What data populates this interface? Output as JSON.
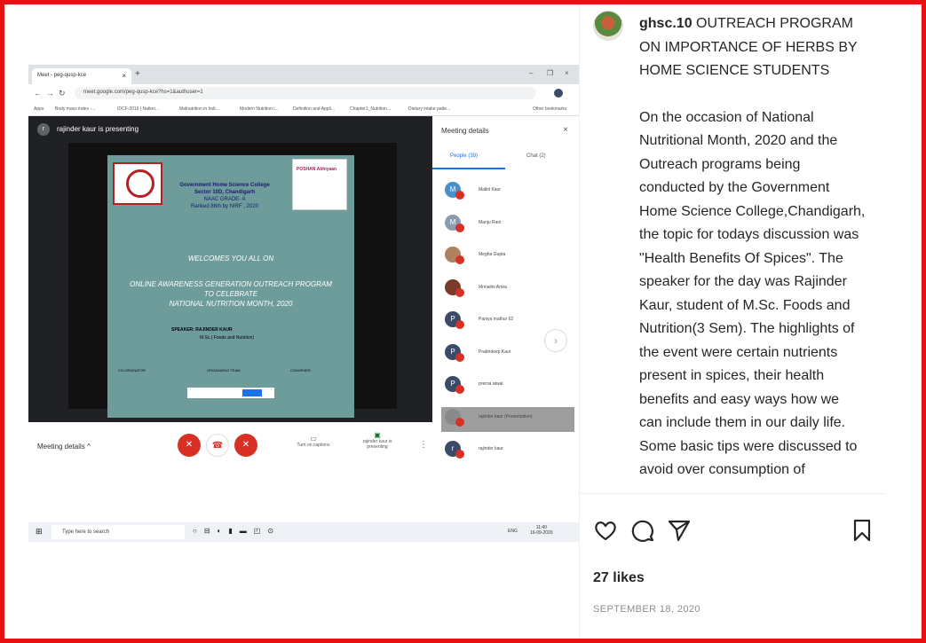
{
  "browser": {
    "tab_title": "Meet - peg-qusp-kce",
    "url": "meet.google.com/peg-qusp-kce?hs=1&authuser=1",
    "bookmarks": [
      "Apps",
      "Body mass index -...",
      "IDCF-2019 | Nation...",
      "Malnutrition in Indi...",
      "Modern Nutrition i...",
      "Definition and Appli...",
      "Chapter1_Nutrition...",
      "Dietary intake patte...",
      "Other bookmarks"
    ]
  },
  "meet": {
    "presenting_label": "rajinder kaur is presenting",
    "presenter_initial": "r",
    "panel_title": "Meeting details",
    "people_tab": "People (39)",
    "chat_tab": "Chat (2)",
    "participants": [
      {
        "initial": "M",
        "name": "Malkit Kaur",
        "color": "#4a90c8"
      },
      {
        "initial": "M",
        "name": "Manju Rani",
        "color": "#8a9bb0"
      },
      {
        "initial": "",
        "name": "Megha Gupta",
        "color": "#b08060"
      },
      {
        "initial": "",
        "name": "Mrinalini Arora",
        "color": "#7a3a2a"
      },
      {
        "initial": "P",
        "name": "Paniya mathur 62",
        "color": "#3c4a6a"
      },
      {
        "initial": "P",
        "name": "Prabhdeep Kaur",
        "color": "#3c4a6a"
      },
      {
        "initial": "P",
        "name": "prerna atwal",
        "color": "#3c4a6a"
      },
      {
        "initial": "",
        "name": "rajinder kaur (Presentation)",
        "color": "#8a8a8a"
      },
      {
        "initial": "r",
        "name": "rajinder kaur",
        "color": "#3c4a6a"
      }
    ],
    "meeting_details": "Meeting details",
    "captions": "Turn on captions",
    "presenting_btn": "rajinder kaur is presenting",
    "taskbar_search": "Type here to search",
    "clock_time": "11:40",
    "clock_lang": "ENG",
    "clock_date": "16-09-2020"
  },
  "slide": {
    "college": "Government Home Science College",
    "sector": "Sector 10D, Chandigarh",
    "naac": "NAAC GRADE- A",
    "nirf": "Ranked 86th by NIRF , 2020",
    "poshan": "POSHAN Abhiyaan",
    "welcome": "WELCOMES YOU ALL ON",
    "program_1": "ONLINE AWARENESS GENERATION OUTREACH PROGRAM",
    "program_2": "TO CELEBRATE",
    "program_3": "NATIONAL NUTRITION MONTH, 2020",
    "speaker": "SPEAKER: RAJINDER KAUR",
    "speaker_deg": "M.Sc.( Foods and Nutrition)",
    "coordinator": "CO-ORDINATOR",
    "team": "ORGANIZING TEAM",
    "convener": "CONVENER:"
  },
  "post": {
    "username": "ghsc.10",
    "title": "OUTREACH PROGRAM ON IMPORTANCE OF HERBS BY HOME SCIENCE STUDENTS",
    "body": "On the occasion of National Nutritional Month, 2020 and the Outreach programs being conducted by the Government Home Science College,Chandigarh,  the topic for todays discussion was \"Health Benefits Of Spices\". The speaker for the day was Rajinder Kaur, student of M.Sc. Foods and Nutrition(3 Sem). The highlights of the event were certain nutrients present in spices, their health benefits and easy ways how we can include them in our daily life. Some basic tips were discussed to avoid over consumption of medicines and immunity boosting decoctions",
    "likes": "27 likes",
    "date": "SEPTEMBER 18, 2020"
  },
  "icons": [
    "heart-icon",
    "comment-icon",
    "share-icon",
    "bookmark-icon"
  ],
  "colors": {
    "frame": "#e81010",
    "meet_red": "#d93025",
    "slide": "#6e9c9b"
  }
}
